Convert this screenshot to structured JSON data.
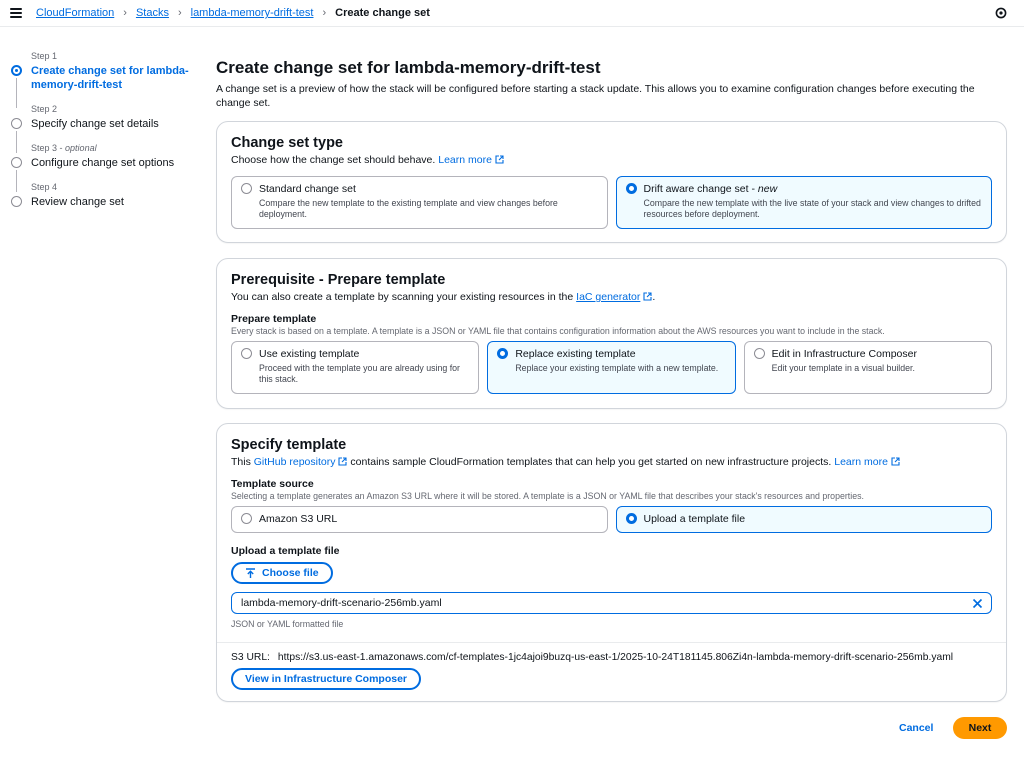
{
  "breadcrumb": {
    "items": [
      "CloudFormation",
      "Stacks",
      "lambda-memory-drift-test"
    ],
    "current": "Create change set"
  },
  "steps": [
    {
      "num": "Step 1",
      "optional": "",
      "title": "Create change set for lambda-memory-drift-test",
      "state": "active"
    },
    {
      "num": "Step 2",
      "optional": "",
      "title": "Specify change set details",
      "state": "pending"
    },
    {
      "num": "Step 3 -",
      "optional": "optional",
      "title": "Configure change set options",
      "state": "pending"
    },
    {
      "num": "Step 4",
      "optional": "",
      "title": "Review change set",
      "state": "pending"
    }
  ],
  "page": {
    "title": "Create change set for lambda-memory-drift-test",
    "description": "A change set is a preview of how the stack will be configured before starting a stack update. This allows you to examine configuration changes before executing the change set."
  },
  "change_set_type": {
    "heading": "Change set type",
    "sub": "Choose how the change set should behave.",
    "learn_more": "Learn more",
    "options": [
      {
        "title": "Standard change set",
        "suffix": "",
        "desc": "Compare the new template to the existing template and view changes before deployment.",
        "selected": false
      },
      {
        "title": "Drift aware change set -",
        "suffix": "new",
        "desc": "Compare the new template with the live state of your stack and view changes to drifted resources before deployment.",
        "selected": true
      }
    ]
  },
  "prerequisite": {
    "heading": "Prerequisite - Prepare template",
    "sub_before": "You can also create a template by scanning your existing resources in the",
    "sub_link": "IaC generator",
    "sub_after": ".",
    "field_label": "Prepare template",
    "field_desc": "Every stack is based on a template. A template is a JSON or YAML file that contains configuration information about the AWS resources you want to include in the stack.",
    "options": [
      {
        "title": "Use existing template",
        "desc": "Proceed with the template you are already using for this stack.",
        "selected": false
      },
      {
        "title": "Replace existing template",
        "desc": "Replace your existing template with a new template.",
        "selected": true
      },
      {
        "title": "Edit in Infrastructure Composer",
        "desc": "Edit your template in a visual builder.",
        "selected": false
      }
    ]
  },
  "specify_template": {
    "heading": "Specify template",
    "sub_before": "This",
    "sub_link": "GitHub repository",
    "sub_middle": "contains sample CloudFormation templates that can help you get started on new infrastructure projects.",
    "learn_more": "Learn more",
    "source_label": "Template source",
    "source_desc": "Selecting a template generates an Amazon S3 URL where it will be stored. A template is a JSON or YAML file that describes your stack's resources and properties.",
    "source_options": [
      {
        "title": "Amazon S3 URL",
        "selected": false
      },
      {
        "title": "Upload a template file",
        "selected": true
      }
    ],
    "upload_label": "Upload a template file",
    "choose_file": "Choose file",
    "file_name": "lambda-memory-drift-scenario-256mb.yaml",
    "constraint": "JSON or YAML formatted file",
    "s3_label": "S3 URL:",
    "s3_url": "https://s3.us-east-1.amazonaws.com/cf-templates-1jc4ajoi9buzq-us-east-1/2025-10-24T181145.806Zi4n-lambda-memory-drift-scenario-256mb.yaml",
    "view_composer": "View in Infrastructure Composer"
  },
  "footer": {
    "cancel": "Cancel",
    "next": "Next"
  },
  "colors": {
    "link": "#006ce0",
    "primary_button": "#ff9900",
    "selected_tile_bg": "#f0fbff"
  }
}
